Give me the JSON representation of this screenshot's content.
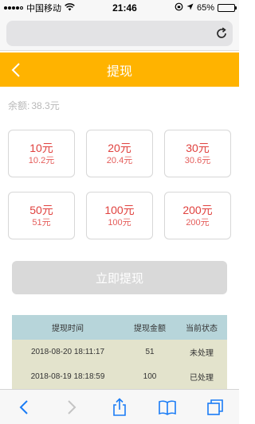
{
  "status_bar": {
    "carrier": "中国移动",
    "time": "21:46",
    "battery": "65%",
    "battery_level": 0.65
  },
  "browser": {
    "url": "",
    "reload_icon": "reload-icon"
  },
  "header": {
    "title": "提现",
    "back_icon": "chevron-left-icon",
    "color": "#ffb300"
  },
  "balance": {
    "label": "余额:",
    "value": "38.3元"
  },
  "options": [
    {
      "amount": "10元",
      "actual": "10.2元"
    },
    {
      "amount": "20元",
      "actual": "20.4元"
    },
    {
      "amount": "30元",
      "actual": "30.6元"
    },
    {
      "amount": "50元",
      "actual": "51元"
    },
    {
      "amount": "100元",
      "actual": "100元"
    },
    {
      "amount": "200元",
      "actual": "200元"
    }
  ],
  "submit": {
    "label": "立即提现"
  },
  "table": {
    "headers": [
      "提现时间",
      "提现金额",
      "当前状态"
    ],
    "rows": [
      [
        "2018-08-20 18:11:17",
        "51",
        "未处理"
      ],
      [
        "2018-08-19 18:18:59",
        "100",
        "已处理"
      ]
    ]
  },
  "toolbar": {
    "icons": [
      "back-arrow-icon",
      "forward-arrow-icon",
      "share-icon",
      "bookmarks-icon",
      "tabs-icon"
    ]
  },
  "colors": {
    "accent": "#ffb300",
    "amount_text": "#e0413e",
    "table_header": "#b7d5da",
    "table_row": "#e3e3cc",
    "disabled_button": "#d9d9d9",
    "toolbar_icon": "#1a7cf5"
  }
}
